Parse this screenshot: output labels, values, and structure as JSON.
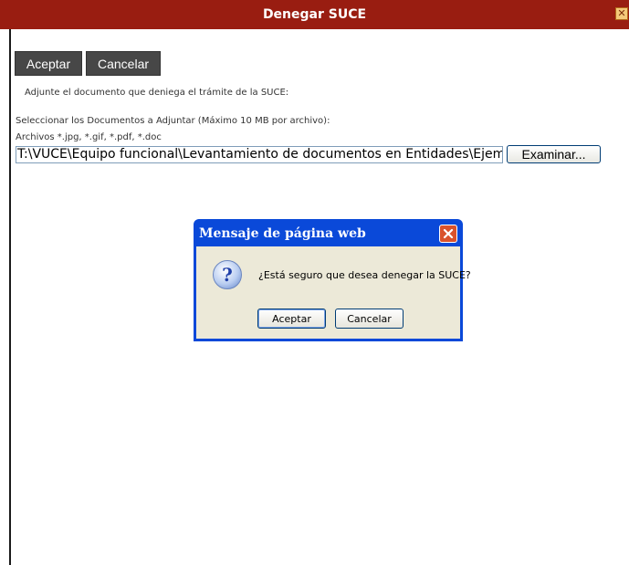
{
  "window": {
    "title": "Denegar SUCE",
    "close_glyph": "⊠"
  },
  "toolbar": {
    "accept_label": "Aceptar",
    "cancel_label": "Cancelar"
  },
  "form": {
    "instruction": "Adjunte el documento que deniega el trámite de la SUCE:",
    "select_label": "Seleccionar los Documentos a Adjuntar (Máximo 10 MB por archivo):",
    "allowed_types": "Archivos *.jpg, *.gif, *.pdf, *.doc",
    "file_value": "T:\\VUCE\\Equipo funcional\\Levantamiento de documentos en Entidades\\Ejemplos Formatos",
    "browse_label": "Examinar..."
  },
  "dialog": {
    "title": "Mensaje de página web",
    "message": "¿Está seguro que desea denegar la SUCE?",
    "icon": "question-icon",
    "ok_label": "Aceptar",
    "cancel_label": "Cancelar"
  },
  "colors": {
    "titlebar": "#991d11",
    "dark_button": "#474747",
    "dialog_frame": "#0a49d9",
    "dialog_body": "#ece9d8"
  }
}
